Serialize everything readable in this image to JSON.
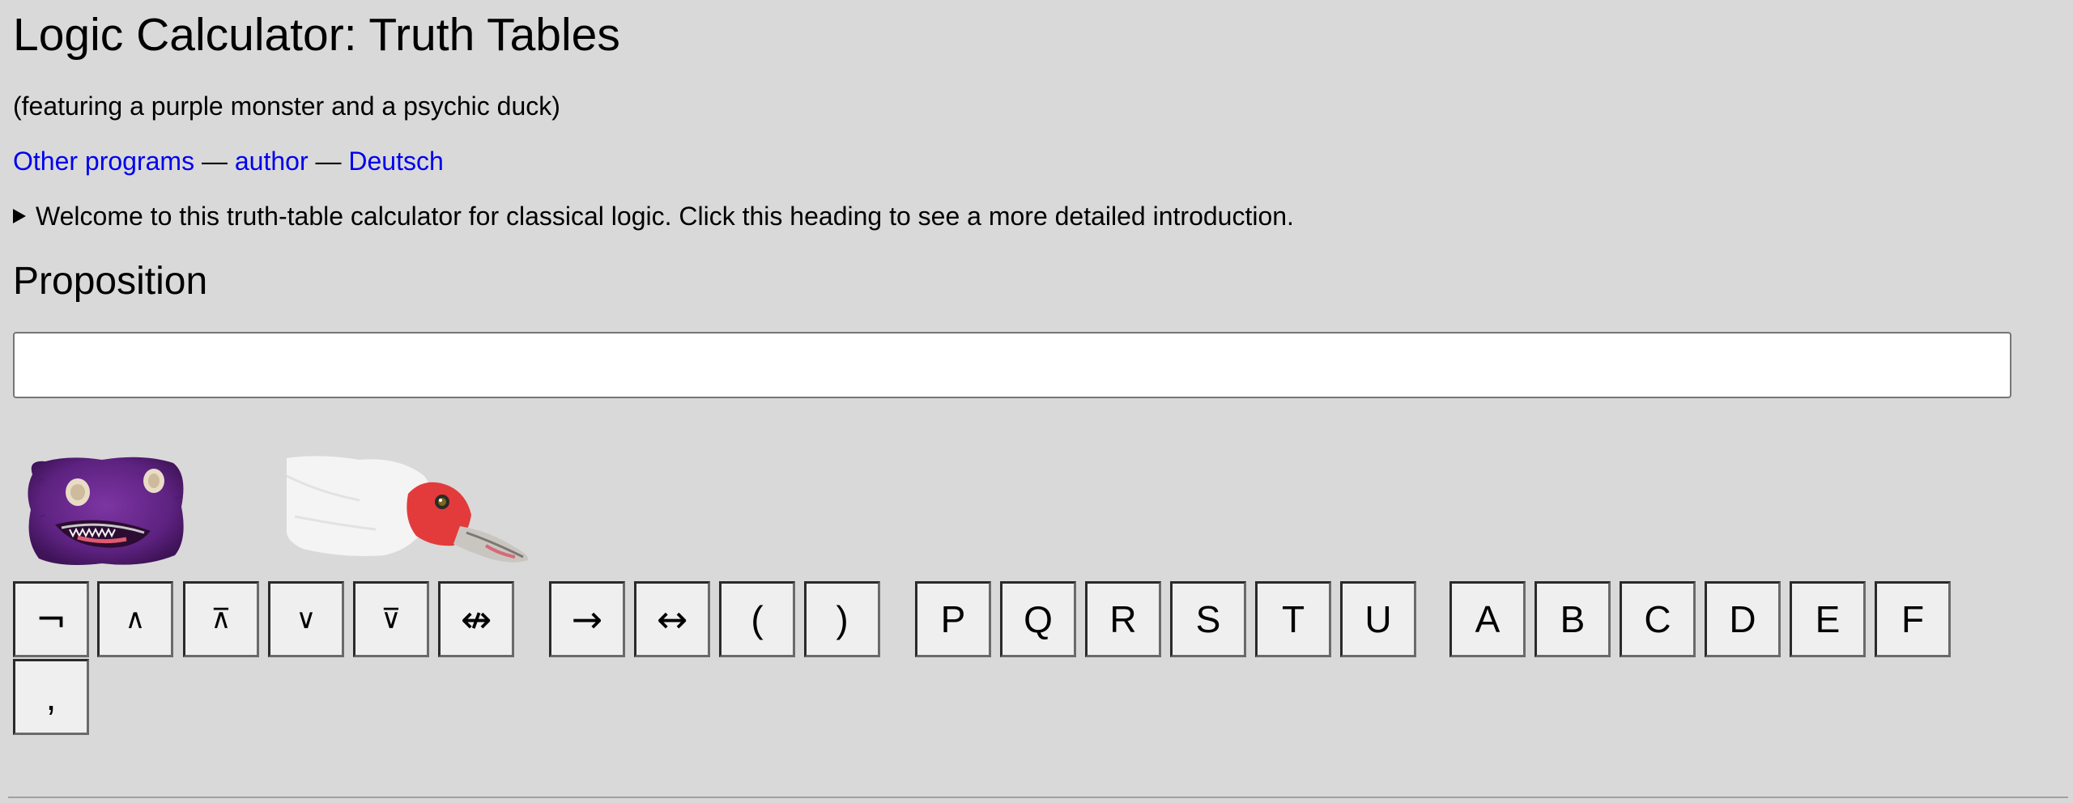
{
  "header": {
    "title": "Logic Calculator: Truth Tables",
    "subtitle": "(featuring a purple monster and a psychic duck)"
  },
  "links": {
    "other_programs": "Other programs",
    "separator": "—",
    "author": "author",
    "deutsch": "Deutsch"
  },
  "intro": {
    "summary": "Welcome to this truth-table calculator for classical logic. Click this heading to see a more detailed introduction."
  },
  "proposition": {
    "heading": "Proposition",
    "value": "",
    "placeholder": ""
  },
  "keyboard": {
    "operators": [
      "¬",
      "∧",
      "⊼",
      "∨",
      "⊽",
      "↮"
    ],
    "connectives": [
      "→",
      "↔",
      "(",
      ")"
    ],
    "variables_pqr": [
      "P",
      "Q",
      "R",
      "S",
      "T",
      "U"
    ],
    "variables_abc": [
      "A",
      "B",
      "C",
      "D",
      "E",
      "F"
    ],
    "comma": ","
  },
  "colors": {
    "background": "#d9d9d9",
    "link": "#0000ee",
    "monster": "#6b2c8c",
    "duck_face": "#e04040"
  }
}
